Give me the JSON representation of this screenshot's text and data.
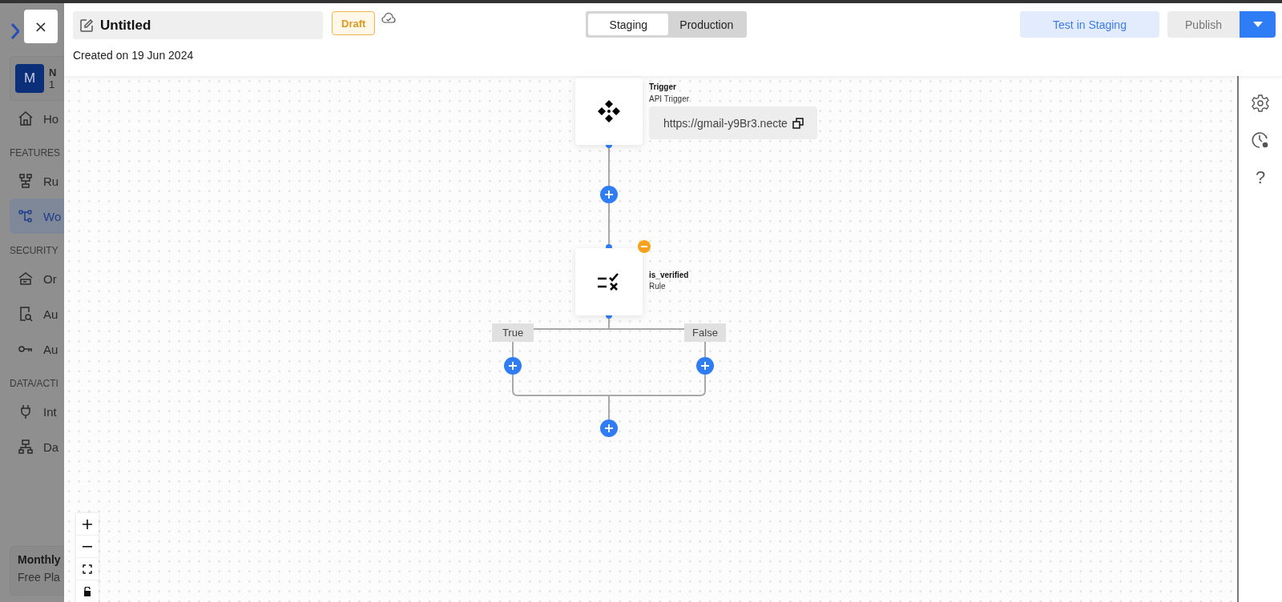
{
  "sidebar": {
    "account": {
      "initial": "M",
      "name": "N",
      "detail": "1"
    },
    "sections": [
      {
        "items": [
          {
            "label": "Ho",
            "selected": false
          }
        ]
      },
      {
        "title": "FEATURES",
        "items": [
          {
            "label": "Ru",
            "selected": false
          },
          {
            "label": "Wo",
            "selected": true
          }
        ]
      },
      {
        "title": "SECURITY",
        "items": [
          {
            "label": "Or",
            "selected": false
          },
          {
            "label": "Au",
            "selected": false
          },
          {
            "label": "Au",
            "selected": false
          }
        ]
      },
      {
        "title": "DATA/ACTI",
        "items": [
          {
            "label": "Int",
            "selected": false
          },
          {
            "label": "Da",
            "selected": false
          }
        ]
      }
    ],
    "plan_card": {
      "title": "Monthly",
      "subtitle": "Free Pla"
    }
  },
  "close_button": "×",
  "header": {
    "title": "Untitled",
    "status": "Draft",
    "created": "Created on 19 Jun 2024",
    "environments": [
      {
        "label": "Staging",
        "selected": true
      },
      {
        "label": "Production",
        "selected": false
      }
    ],
    "test_button": "Test in Staging",
    "publish_button": {
      "label": "Publish",
      "disabled": true
    }
  },
  "canvas": {
    "trigger": {
      "title": "Trigger",
      "subtitle": "API Trigger",
      "url": "https://gmail-y9Br3.necte"
    },
    "rule": {
      "title": "is_verified",
      "subtitle": "Rule"
    },
    "branches": [
      "True",
      "False"
    ]
  },
  "right_rail": {
    "help": "?"
  }
}
